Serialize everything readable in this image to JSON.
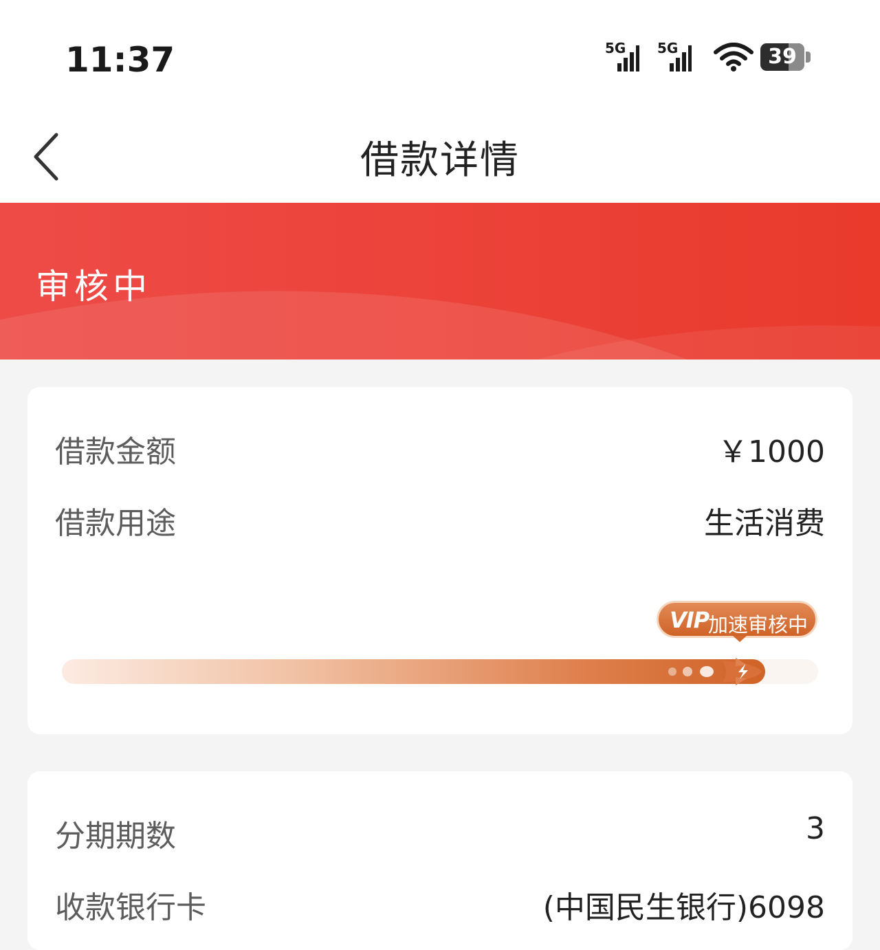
{
  "status_bar": {
    "time": "11:37",
    "sim1_label": "5G",
    "sim2_label": "5G",
    "battery": "39",
    "battery_level": 0.39,
    "icons": [
      "signal-icon",
      "signal-icon",
      "wifi-icon",
      "battery-icon"
    ]
  },
  "header": {
    "title": "借款详情",
    "back_icon": "chevron-left-icon"
  },
  "banner": {
    "status": "审核中",
    "color_start": "#ee4b47",
    "color_end": "#e93a2c"
  },
  "loan": {
    "amount_label": "借款金额",
    "amount_value": "￥1000",
    "purpose_label": "借款用途",
    "purpose_value": "生活消费",
    "progress": {
      "fraction": 0.93,
      "badge_vip": "VIP",
      "badge_text": "加速审核中",
      "accent": "#cf6327"
    }
  },
  "details": {
    "installments_label": "分期期数",
    "installments_value": "3",
    "bank_card_label": "收款银行卡",
    "bank_card_value": "(中国民生银行)6098"
  }
}
